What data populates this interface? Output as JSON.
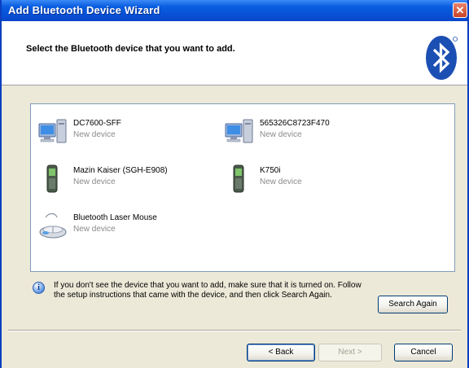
{
  "window": {
    "title": "Add Bluetooth Device Wizard",
    "close_symbol": "✕"
  },
  "header": {
    "instruction": "Select the Bluetooth device that you want to add.",
    "logo_icon": "bluetooth-logo-icon"
  },
  "devices": [
    {
      "name": "DC7600-SFF",
      "status": "New device",
      "icon": "computer-icon"
    },
    {
      "name": "565326C8723F470",
      "status": "New device",
      "icon": "computer-icon"
    },
    {
      "name": "Mazin Kaiser (SGH-E908)",
      "status": "New device",
      "icon": "mobile-phone-icon"
    },
    {
      "name": "K750i",
      "status": "New device",
      "icon": "mobile-phone-icon"
    },
    {
      "name": "Bluetooth Laser Mouse",
      "status": "New device",
      "icon": "mouse-icon"
    }
  ],
  "info": {
    "icon": "info-icon",
    "text": "If you don't see the device that you want to add, make sure that it is turned on. Follow the setup instructions that came with the device, and then click Search Again."
  },
  "buttons": {
    "search_again": "Search Again",
    "back": "< Back",
    "next": "Next >",
    "cancel": "Cancel"
  },
  "colors": {
    "titlebar": "#0a5ee0",
    "dialog_background": "#ece9d8",
    "bluetooth_blue": "#1c4fb3"
  }
}
